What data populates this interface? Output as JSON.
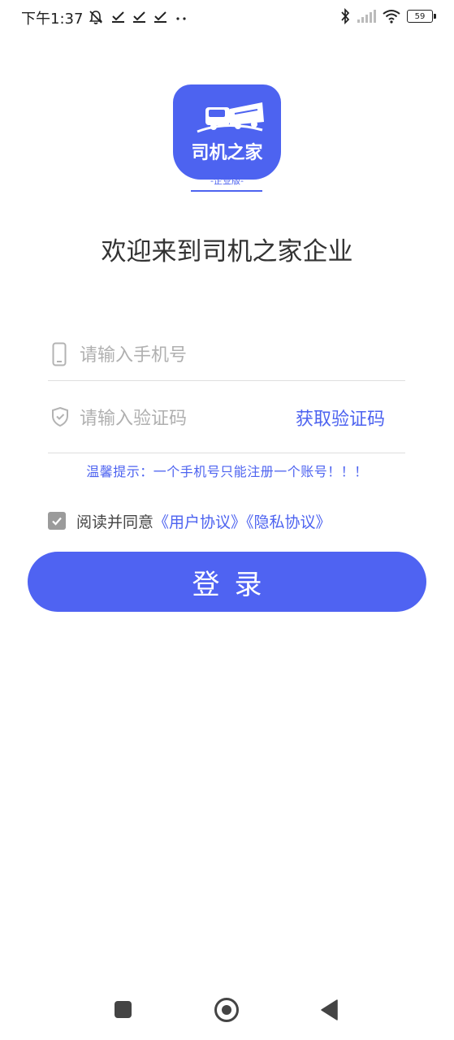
{
  "status_bar": {
    "time": "下午1:37",
    "battery": "59",
    "icons": [
      "muted-alarm-icon",
      "check-icon",
      "check-icon",
      "check-icon",
      "dots-icon",
      "bluetooth-icon",
      "signal-icon",
      "wifi-icon",
      "battery-icon"
    ]
  },
  "logo": {
    "title": "司机之家",
    "subtitle": "-企业版-"
  },
  "welcome": "欢迎来到司机之家企业",
  "form": {
    "phone_placeholder": "请输入手机号",
    "phone_value": "",
    "code_placeholder": "请输入验证码",
    "code_value": "",
    "get_code_label": "获取验证码"
  },
  "tip": "温馨提示：一个手机号只能注册一个账号！！！",
  "agreement": {
    "checked": true,
    "prefix": "阅读并同意",
    "user_agreement": "《用户协议》",
    "privacy_policy": "《隐私协议》"
  },
  "login_label": "登录",
  "colors": {
    "accent": "#4d63f0",
    "placeholder": "#b0b0b0",
    "text": "#333333"
  }
}
